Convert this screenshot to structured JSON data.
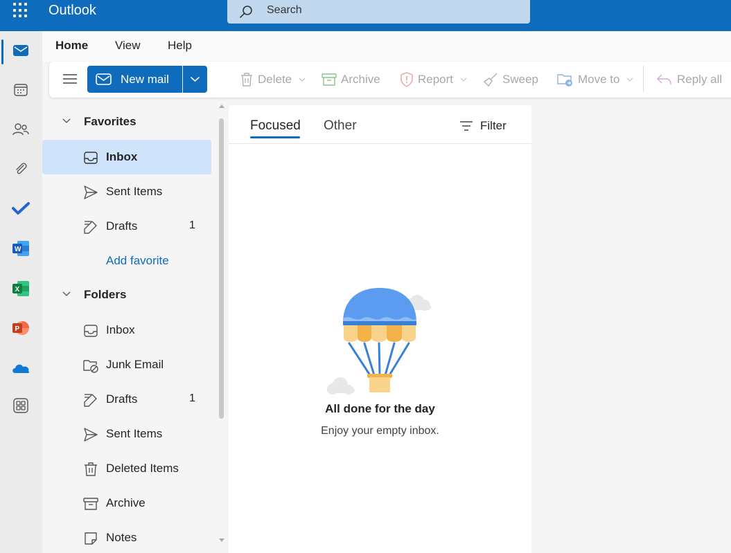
{
  "app": {
    "title": "Outlook"
  },
  "search": {
    "placeholder": "Search"
  },
  "ribbon": {
    "tabs": [
      {
        "label": "Home",
        "active": true
      },
      {
        "label": "View"
      },
      {
        "label": "Help"
      }
    ],
    "toolbar": {
      "new_mail": "New mail",
      "delete": "Delete",
      "archive": "Archive",
      "report": "Report",
      "sweep": "Sweep",
      "move_to": "Move to",
      "reply_all": "Reply all"
    }
  },
  "rail": {
    "items": [
      "mail-icon",
      "calendar-icon",
      "people-icon",
      "attachment-icon",
      "todo-icon",
      "word-icon",
      "excel-icon",
      "powerpoint-icon",
      "onedrive-icon",
      "more-apps-icon"
    ]
  },
  "favorites": {
    "label": "Favorites",
    "items": [
      {
        "label": "Inbox",
        "icon": "inbox-icon",
        "selected": true
      },
      {
        "label": "Sent Items",
        "icon": "send-icon"
      },
      {
        "label": "Drafts",
        "icon": "drafts-icon",
        "count": "1"
      }
    ],
    "add_label": "Add favorite"
  },
  "folders": {
    "label": "Folders",
    "items": [
      {
        "label": "Inbox",
        "icon": "inbox-icon"
      },
      {
        "label": "Junk Email",
        "icon": "junk-icon"
      },
      {
        "label": "Drafts",
        "icon": "drafts-icon",
        "count": "1"
      },
      {
        "label": "Sent Items",
        "icon": "send-icon"
      },
      {
        "label": "Deleted Items",
        "icon": "trash-icon"
      },
      {
        "label": "Archive",
        "icon": "archive-icon"
      },
      {
        "label": "Notes",
        "icon": "notes-icon"
      }
    ]
  },
  "message_list": {
    "tabs": [
      {
        "label": "Focused",
        "active": true
      },
      {
        "label": "Other"
      }
    ],
    "filter_label": "Filter",
    "empty": {
      "title": "All done for the day",
      "subtitle": "Enjoy your empty inbox."
    }
  },
  "colors": {
    "brand": "#0f6cbd",
    "selected": "#cfe4fa"
  }
}
